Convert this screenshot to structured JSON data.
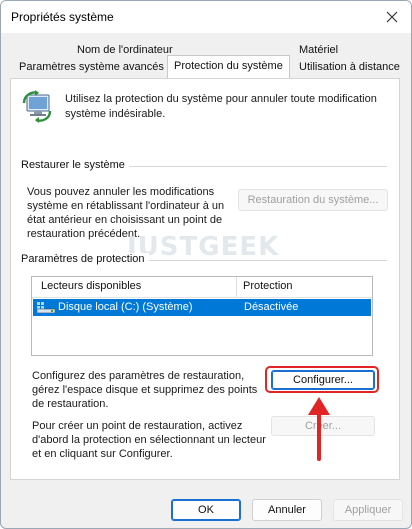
{
  "window": {
    "title": "Propriétés système"
  },
  "tabs": [
    {
      "label": "Nom de l'ordinateur"
    },
    {
      "label": "Matériel"
    },
    {
      "label": "Paramètres système avancés"
    },
    {
      "label": "Protection du système",
      "active": true
    },
    {
      "label": "Utilisation à distance"
    }
  ],
  "intro": {
    "text": "Utilisez la protection du système pour annuler toute modification système indésirable."
  },
  "restore": {
    "heading": "Restaurer le système",
    "text": "Vous pouvez annuler les modifications système en rétablissant l'ordinateur à un état antérieur en choisissant un point de restauration précédent.",
    "button_label": "Restauration du système..."
  },
  "protection": {
    "heading": "Paramètres de protection",
    "columns": [
      "Lecteurs disponibles",
      "Protection"
    ],
    "rows": [
      {
        "drive": "Disque local (C:) (Système)",
        "status": "Désactivée",
        "selected": true
      }
    ],
    "configure_text": "Configurez des paramètres de restauration, gérez l'espace disque et supprimez des points de restauration.",
    "configure_label": "Configurer...",
    "create_text": "Pour créer un point de restauration, activez d'abord la protection en sélectionnant un lecteur et en cliquant sur Configurer.",
    "create_label": "Créer..."
  },
  "footer": {
    "ok_label": "OK",
    "cancel_label": "Annuler",
    "apply_label": "Appliquer"
  },
  "watermark": "JUSTGEEK",
  "colors": {
    "selection": "#0078d7",
    "highlight": "#e12424",
    "accent_border": "#1a6fd0"
  },
  "icons": {
    "close": "close-icon",
    "system_protection": "system-protection-icon",
    "drive": "drive-icon",
    "arrow": "arrow-up-icon"
  }
}
